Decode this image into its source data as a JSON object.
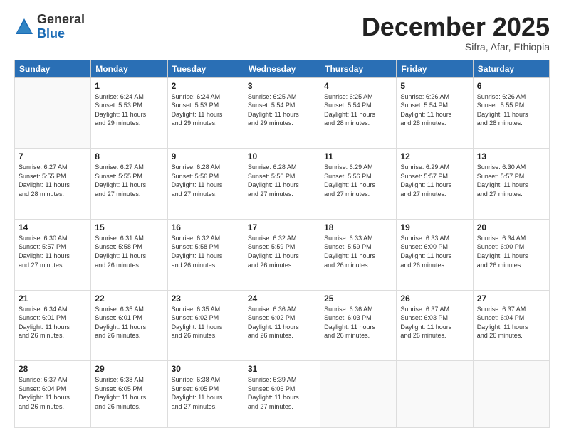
{
  "header": {
    "logo_line1": "General",
    "logo_line2": "Blue",
    "month": "December 2025",
    "location": "Sifra, Afar, Ethiopia"
  },
  "weekdays": [
    "Sunday",
    "Monday",
    "Tuesday",
    "Wednesday",
    "Thursday",
    "Friday",
    "Saturday"
  ],
  "weeks": [
    [
      {
        "day": "",
        "info": ""
      },
      {
        "day": "1",
        "info": "Sunrise: 6:24 AM\nSunset: 5:53 PM\nDaylight: 11 hours\nand 29 minutes."
      },
      {
        "day": "2",
        "info": "Sunrise: 6:24 AM\nSunset: 5:53 PM\nDaylight: 11 hours\nand 29 minutes."
      },
      {
        "day": "3",
        "info": "Sunrise: 6:25 AM\nSunset: 5:54 PM\nDaylight: 11 hours\nand 29 minutes."
      },
      {
        "day": "4",
        "info": "Sunrise: 6:25 AM\nSunset: 5:54 PM\nDaylight: 11 hours\nand 28 minutes."
      },
      {
        "day": "5",
        "info": "Sunrise: 6:26 AM\nSunset: 5:54 PM\nDaylight: 11 hours\nand 28 minutes."
      },
      {
        "day": "6",
        "info": "Sunrise: 6:26 AM\nSunset: 5:55 PM\nDaylight: 11 hours\nand 28 minutes."
      }
    ],
    [
      {
        "day": "7",
        "info": "Sunrise: 6:27 AM\nSunset: 5:55 PM\nDaylight: 11 hours\nand 28 minutes."
      },
      {
        "day": "8",
        "info": "Sunrise: 6:27 AM\nSunset: 5:55 PM\nDaylight: 11 hours\nand 27 minutes."
      },
      {
        "day": "9",
        "info": "Sunrise: 6:28 AM\nSunset: 5:56 PM\nDaylight: 11 hours\nand 27 minutes."
      },
      {
        "day": "10",
        "info": "Sunrise: 6:28 AM\nSunset: 5:56 PM\nDaylight: 11 hours\nand 27 minutes."
      },
      {
        "day": "11",
        "info": "Sunrise: 6:29 AM\nSunset: 5:56 PM\nDaylight: 11 hours\nand 27 minutes."
      },
      {
        "day": "12",
        "info": "Sunrise: 6:29 AM\nSunset: 5:57 PM\nDaylight: 11 hours\nand 27 minutes."
      },
      {
        "day": "13",
        "info": "Sunrise: 6:30 AM\nSunset: 5:57 PM\nDaylight: 11 hours\nand 27 minutes."
      }
    ],
    [
      {
        "day": "14",
        "info": "Sunrise: 6:30 AM\nSunset: 5:57 PM\nDaylight: 11 hours\nand 27 minutes."
      },
      {
        "day": "15",
        "info": "Sunrise: 6:31 AM\nSunset: 5:58 PM\nDaylight: 11 hours\nand 26 minutes."
      },
      {
        "day": "16",
        "info": "Sunrise: 6:32 AM\nSunset: 5:58 PM\nDaylight: 11 hours\nand 26 minutes."
      },
      {
        "day": "17",
        "info": "Sunrise: 6:32 AM\nSunset: 5:59 PM\nDaylight: 11 hours\nand 26 minutes."
      },
      {
        "day": "18",
        "info": "Sunrise: 6:33 AM\nSunset: 5:59 PM\nDaylight: 11 hours\nand 26 minutes."
      },
      {
        "day": "19",
        "info": "Sunrise: 6:33 AM\nSunset: 6:00 PM\nDaylight: 11 hours\nand 26 minutes."
      },
      {
        "day": "20",
        "info": "Sunrise: 6:34 AM\nSunset: 6:00 PM\nDaylight: 11 hours\nand 26 minutes."
      }
    ],
    [
      {
        "day": "21",
        "info": "Sunrise: 6:34 AM\nSunset: 6:01 PM\nDaylight: 11 hours\nand 26 minutes."
      },
      {
        "day": "22",
        "info": "Sunrise: 6:35 AM\nSunset: 6:01 PM\nDaylight: 11 hours\nand 26 minutes."
      },
      {
        "day": "23",
        "info": "Sunrise: 6:35 AM\nSunset: 6:02 PM\nDaylight: 11 hours\nand 26 minutes."
      },
      {
        "day": "24",
        "info": "Sunrise: 6:36 AM\nSunset: 6:02 PM\nDaylight: 11 hours\nand 26 minutes."
      },
      {
        "day": "25",
        "info": "Sunrise: 6:36 AM\nSunset: 6:03 PM\nDaylight: 11 hours\nand 26 minutes."
      },
      {
        "day": "26",
        "info": "Sunrise: 6:37 AM\nSunset: 6:03 PM\nDaylight: 11 hours\nand 26 minutes."
      },
      {
        "day": "27",
        "info": "Sunrise: 6:37 AM\nSunset: 6:04 PM\nDaylight: 11 hours\nand 26 minutes."
      }
    ],
    [
      {
        "day": "28",
        "info": "Sunrise: 6:37 AM\nSunset: 6:04 PM\nDaylight: 11 hours\nand 26 minutes."
      },
      {
        "day": "29",
        "info": "Sunrise: 6:38 AM\nSunset: 6:05 PM\nDaylight: 11 hours\nand 26 minutes."
      },
      {
        "day": "30",
        "info": "Sunrise: 6:38 AM\nSunset: 6:05 PM\nDaylight: 11 hours\nand 27 minutes."
      },
      {
        "day": "31",
        "info": "Sunrise: 6:39 AM\nSunset: 6:06 PM\nDaylight: 11 hours\nand 27 minutes."
      },
      {
        "day": "",
        "info": ""
      },
      {
        "day": "",
        "info": ""
      },
      {
        "day": "",
        "info": ""
      }
    ]
  ]
}
